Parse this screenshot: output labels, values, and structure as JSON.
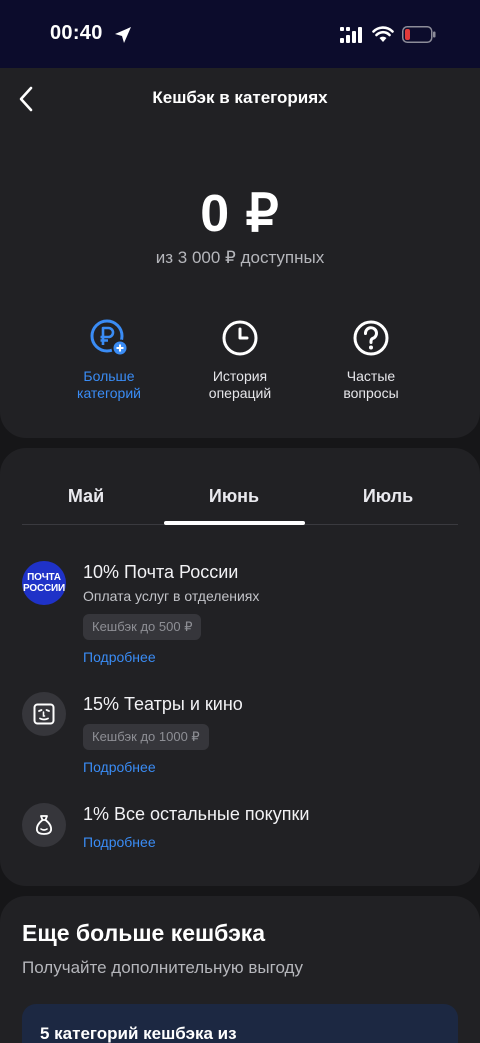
{
  "status_bar": {
    "time": "00:40",
    "icons": [
      "location-arrow-icon",
      "signal-icon",
      "wifi-icon",
      "battery-low-icon"
    ]
  },
  "header": {
    "title": "Кешбэк в категориях",
    "back_icon": "chevron-left-icon"
  },
  "summary": {
    "amount": "0 ₽",
    "available": "из 3 000 ₽ доступных"
  },
  "actions": [
    {
      "line1": "Больше",
      "line2": "категорий",
      "icon": "ruble-plus-icon",
      "color": "#3a8cf5"
    },
    {
      "line1": "История",
      "line2": "операций",
      "icon": "clock-icon"
    },
    {
      "line1": "Частые",
      "line2": "вопросы",
      "icon": "question-icon"
    }
  ],
  "tabs": [
    {
      "label": "Май"
    },
    {
      "label": "Июнь",
      "selected": true
    },
    {
      "label": "Июль"
    }
  ],
  "categories": [
    {
      "logo_text_1": "ПОЧТА",
      "logo_text_2": "РОССИИ",
      "title": "10% Почта России",
      "subtitle": "Оплата услуг в отделениях",
      "chip": "Кешбэк до 500 ₽",
      "link": "Подробнее"
    },
    {
      "icon": "cinema-face-icon",
      "title": "15% Театры и кино",
      "chip": "Кешбэк до 1000 ₽",
      "link": "Подробнее"
    },
    {
      "icon": "money-bag-icon",
      "title": "1% Все остальные покупки",
      "link": "Подробнее"
    }
  ],
  "promo": {
    "title": "Еще больше кешбэка",
    "subtitle": "Получайте дополнительную выгоду",
    "inner_text": "5 категорий кешбэка из"
  },
  "colors": {
    "accent": "#3a8cf5",
    "background": "#161618",
    "card": "#212124",
    "status_bar": "#0c0c2c",
    "pochta_brand": "#1f32c8",
    "battery_low": "#e23a3a"
  }
}
